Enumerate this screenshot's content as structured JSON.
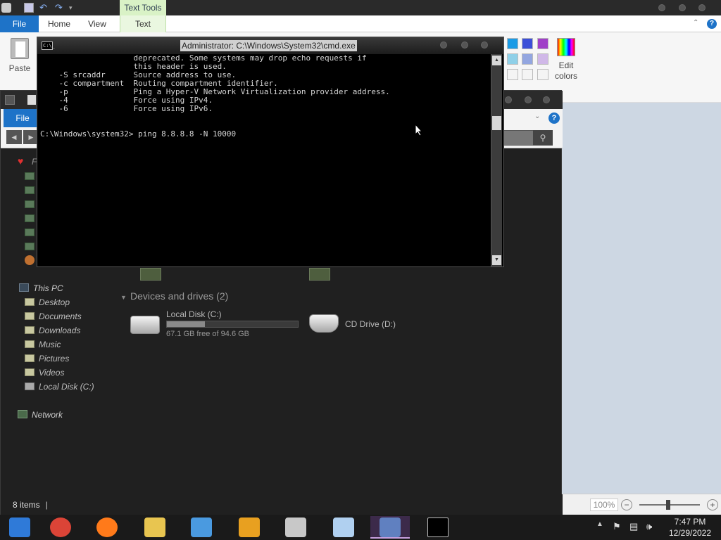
{
  "paint": {
    "contextual_tab": "Text Tools",
    "tabs": [
      "File",
      "Home",
      "View",
      "Text"
    ],
    "paste_label": "Paste",
    "edit_colors_label": "Edit colors",
    "zoom": "100%",
    "zoom_minus": "−",
    "zoom_plus": "+",
    "palette": [
      "#1a9be6",
      "#3b4fd8",
      "#a040c8",
      "#8fd0e8",
      "#93a6e0",
      "#d0b8e8"
    ]
  },
  "explorer": {
    "file_tab": "File",
    "help": "?",
    "nav_partial_label": "F",
    "nav": {
      "this_pc": "This PC",
      "items": [
        "Desktop",
        "Documents",
        "Downloads",
        "Music",
        "Pictures",
        "Videos",
        "Local Disk (C:)"
      ],
      "network": "Network"
    },
    "section_title": "Devices and drives (2)",
    "drives": [
      {
        "name": "Local Disk (C:)",
        "free": "67.1 GB free of 94.6 GB",
        "used_fraction": 0.29
      },
      {
        "name": "CD Drive (D:)"
      }
    ],
    "status_items": "8 items"
  },
  "cmd": {
    "title": "Administrator: C:\\Windows\\System32\\cmd.exe",
    "icon_text": "C:\\_",
    "lines": [
      "                    deprecated. Some systems may drop echo requests if",
      "                    this header is used.",
      "    -S srcaddr      Source address to use.",
      "    -c compartment  Routing compartment identifier.",
      "    -p              Ping a Hyper-V Network Virtualization provider address.",
      "    -4              Force using IPv4.",
      "    -6              Force using IPv6.",
      "",
      "",
      "C:\\Windows\\system32> ping 8.8.8.8 -N 10000"
    ]
  },
  "taskbar": {
    "apps": [
      {
        "name": "windows-media-player",
        "color": "#2f7ad8"
      },
      {
        "name": "chrome",
        "color": "#db4437"
      },
      {
        "name": "firefox",
        "color": "#ff7a1a"
      },
      {
        "name": "file-explorer",
        "color": "#e8c550"
      },
      {
        "name": "people",
        "color": "#4a9ae0"
      },
      {
        "name": "reader",
        "color": "#e8a020"
      },
      {
        "name": "computer",
        "color": "#c8c8c8"
      },
      {
        "name": "paint",
        "color": "#b0d0f0"
      },
      {
        "name": "screen-capture",
        "color": "#6080c0"
      },
      {
        "name": "cmd",
        "color": "#000000"
      }
    ],
    "time": "7:47 PM",
    "date": "12/29/2022"
  }
}
